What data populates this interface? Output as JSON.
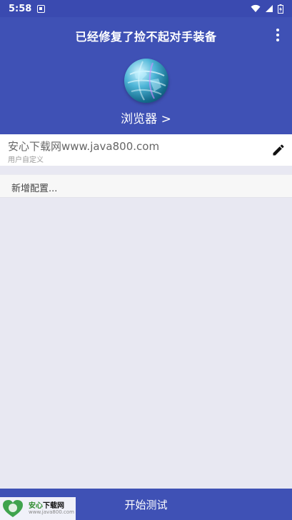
{
  "status_bar": {
    "time": "5:58",
    "icons": [
      "notification-icon",
      "wifi-icon",
      "signal-icon",
      "battery-icon"
    ]
  },
  "header": {
    "title": "已经修复了捡不起对手装备",
    "menu_icon": "more-vert-icon",
    "app_icon": "globe-icon",
    "browser_link": "浏览器 >"
  },
  "config": {
    "name": "安心下载网www.java800.com",
    "subtitle": "用户自定义",
    "edit_icon": "pencil-icon"
  },
  "add_config": {
    "label": "新增配置..."
  },
  "bottom": {
    "start_label": "开始测试"
  },
  "watermark": {
    "name_green": "安心",
    "name_dark": "下载网",
    "url": "www.java800.com"
  },
  "colors": {
    "primary": "#3f51b5",
    "status_bar": "#3a4ab0",
    "background": "#e8e8f2"
  }
}
